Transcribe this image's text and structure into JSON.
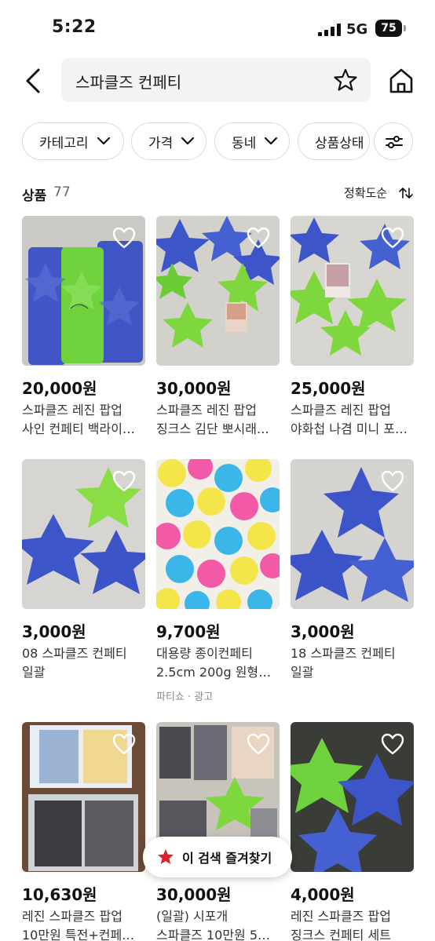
{
  "status": {
    "time": "5:22",
    "network": "5G",
    "battery": "75"
  },
  "search": {
    "query": "스파클즈 컨페티"
  },
  "filters": [
    {
      "label": "카테고리"
    },
    {
      "label": "가격"
    },
    {
      "label": "동네"
    },
    {
      "label": "상품상태"
    }
  ],
  "results": {
    "label": "상품",
    "count": "77",
    "sort": "정확도순"
  },
  "products": [
    {
      "price": "20,000원",
      "line1": "스파클즈 레진 팝업",
      "line2": "사인 컨페티 백라이…",
      "meta": "",
      "image": "blue-green-star-confetti-bags"
    },
    {
      "price": "30,000원",
      "line1": "스파클즈 레진 팝업",
      "line2": "징크스 김단 뽀시래…",
      "meta": "",
      "image": "blue-green-star-confetti-card"
    },
    {
      "price": "25,000원",
      "line1": "스파클즈 레진 팝업",
      "line2": "야화첩 나겸 미니 포…",
      "meta": "",
      "image": "green-star-confetti-card"
    },
    {
      "price": "3,000원",
      "line1": "08 스파클즈 컨페티",
      "line2": "일괄",
      "meta": "",
      "image": "blue-green-star-confetti"
    },
    {
      "price": "9,700원",
      "line1": "대용량 종이컨페티",
      "line2": "2.5cm 200g 원형…",
      "meta": "파티쇼 · 광고",
      "image": "colorful-round-confetti"
    },
    {
      "price": "3,000원",
      "line1": "18 스파클즈 컨페티",
      "line2": "일괄",
      "meta": "",
      "image": "blue-star-confetti"
    },
    {
      "price": "10,630원",
      "line1": "레진 스파클즈 팝업",
      "line2": "10만원 특전+컨페…",
      "meta": "",
      "image": "manhwa-photo-cards"
    },
    {
      "price": "30,000원",
      "line1": "(일괄) 시포개",
      "line2": "스파클즈 10만원 5…",
      "meta": "",
      "image": "manhwa-cards-green-star"
    },
    {
      "price": "4,000원",
      "line1": "레진 스파클즈 팝업",
      "line2": "징크스 컨페티 세트",
      "meta": "",
      "image": "green-blue-star-confetti"
    }
  ],
  "favorite_toast": {
    "label": "이 검색 즐겨찾기"
  },
  "colors": {
    "accent": "#e0202a",
    "blue_confetti": "#3b55c9",
    "green_confetti": "#7fd63a"
  },
  "icons": [
    "back-arrow-icon",
    "star-outline-icon",
    "home-icon",
    "chevron-down-icon",
    "filter-sliders-icon",
    "sort-arrows-icon",
    "heart-outline-icon",
    "star-filled-icon"
  ]
}
